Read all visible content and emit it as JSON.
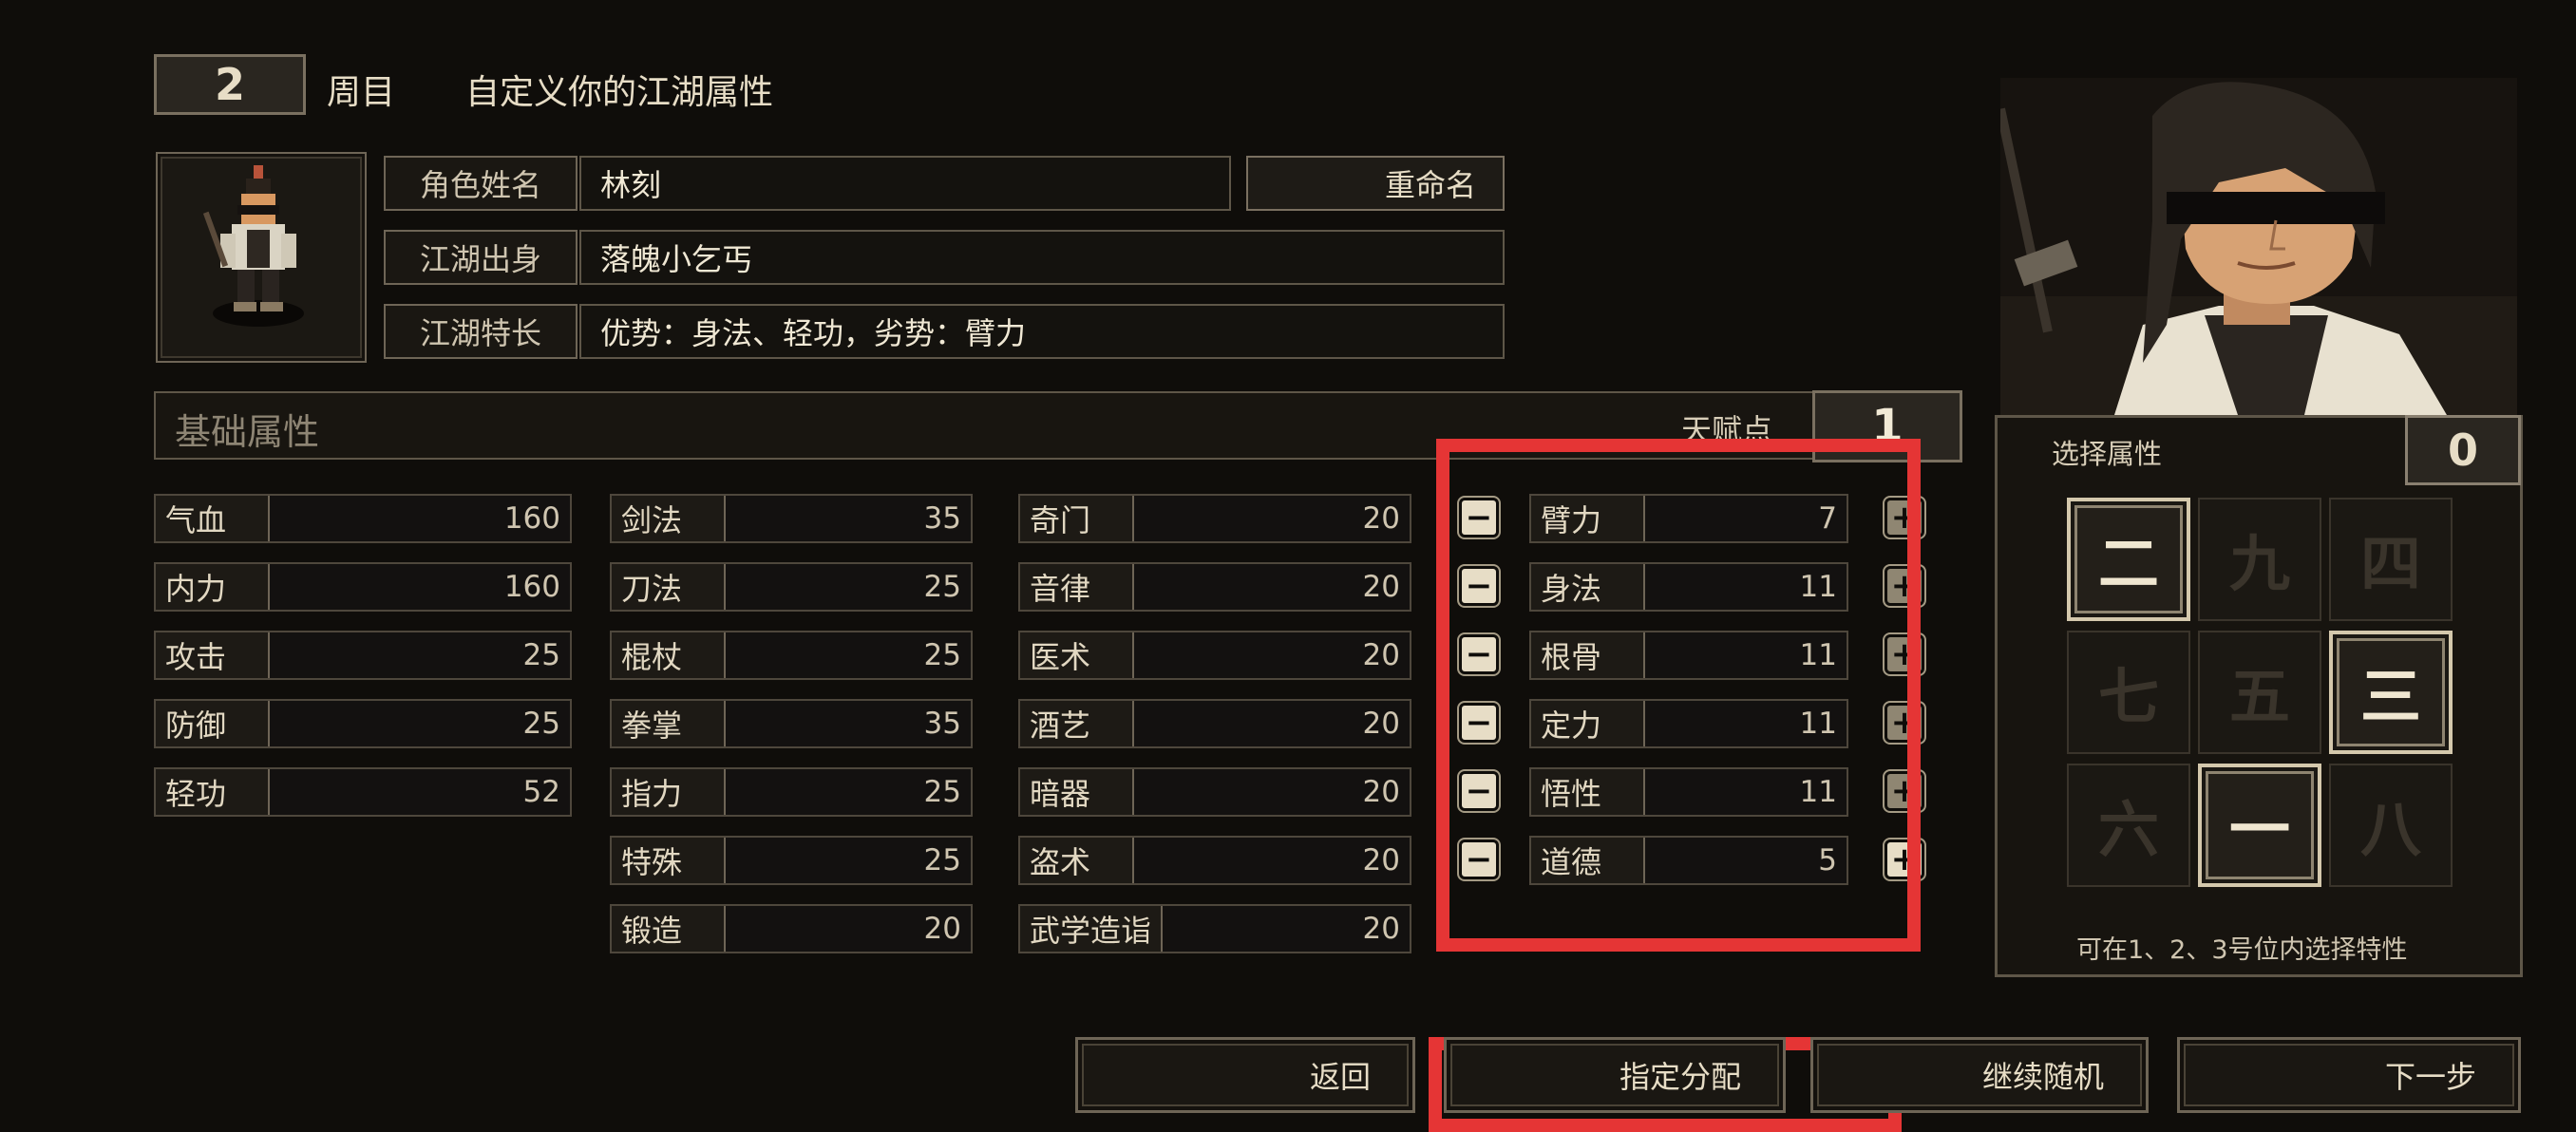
{
  "header": {
    "cycle_number": "2",
    "cycle_label": "周目",
    "subtitle": "自定义你的江湖属性"
  },
  "info": {
    "name_label": "角色姓名",
    "name_value": "林刻",
    "rename_label": "重命名",
    "origin_label": "江湖出身",
    "origin_value": "落魄小乞丐",
    "trait_label": "江湖特长",
    "trait_value": "优势：身法、轻功，劣势：臂力"
  },
  "section": {
    "title": "基础属性",
    "talent_label": "天赋点",
    "talent_points": "1"
  },
  "stats": {
    "col1": [
      {
        "name": "气血",
        "value": "160"
      },
      {
        "name": "内力",
        "value": "160"
      },
      {
        "name": "攻击",
        "value": "25"
      },
      {
        "name": "防御",
        "value": "25"
      },
      {
        "name": "轻功",
        "value": "52"
      }
    ],
    "col2": [
      {
        "name": "剑法",
        "value": "35"
      },
      {
        "name": "刀法",
        "value": "25"
      },
      {
        "name": "棍杖",
        "value": "25"
      },
      {
        "name": "拳掌",
        "value": "35"
      },
      {
        "name": "指力",
        "value": "25"
      },
      {
        "name": "特殊",
        "value": "25"
      },
      {
        "name": "锻造",
        "value": "20"
      }
    ],
    "col3": [
      {
        "name": "奇门",
        "value": "20"
      },
      {
        "name": "音律",
        "value": "20"
      },
      {
        "name": "医术",
        "value": "20"
      },
      {
        "name": "酒艺",
        "value": "20"
      },
      {
        "name": "暗器",
        "value": "20"
      },
      {
        "name": "盗术",
        "value": "20"
      },
      {
        "name": "武学造诣",
        "value": "20"
      }
    ],
    "base": [
      {
        "name": "臂力",
        "value": "7"
      },
      {
        "name": "身法",
        "value": "11"
      },
      {
        "name": "根骨",
        "value": "11"
      },
      {
        "name": "定力",
        "value": "11"
      },
      {
        "name": "悟性",
        "value": "11"
      },
      {
        "name": "道德",
        "value": "5"
      }
    ]
  },
  "panel": {
    "title": "选择属性",
    "count": "0",
    "grid": [
      "二",
      "九",
      "四",
      "七",
      "五",
      "三",
      "六",
      "一",
      "八"
    ],
    "hint": "可在1、2、3号位内选择特性"
  },
  "buttons": {
    "back": "返回",
    "assign": "指定分配",
    "random": "继续随机",
    "next": "下一步"
  },
  "colors": {
    "background": "#0f0d0a",
    "highlight": "#e53535",
    "text": "#e7ddc6"
  }
}
